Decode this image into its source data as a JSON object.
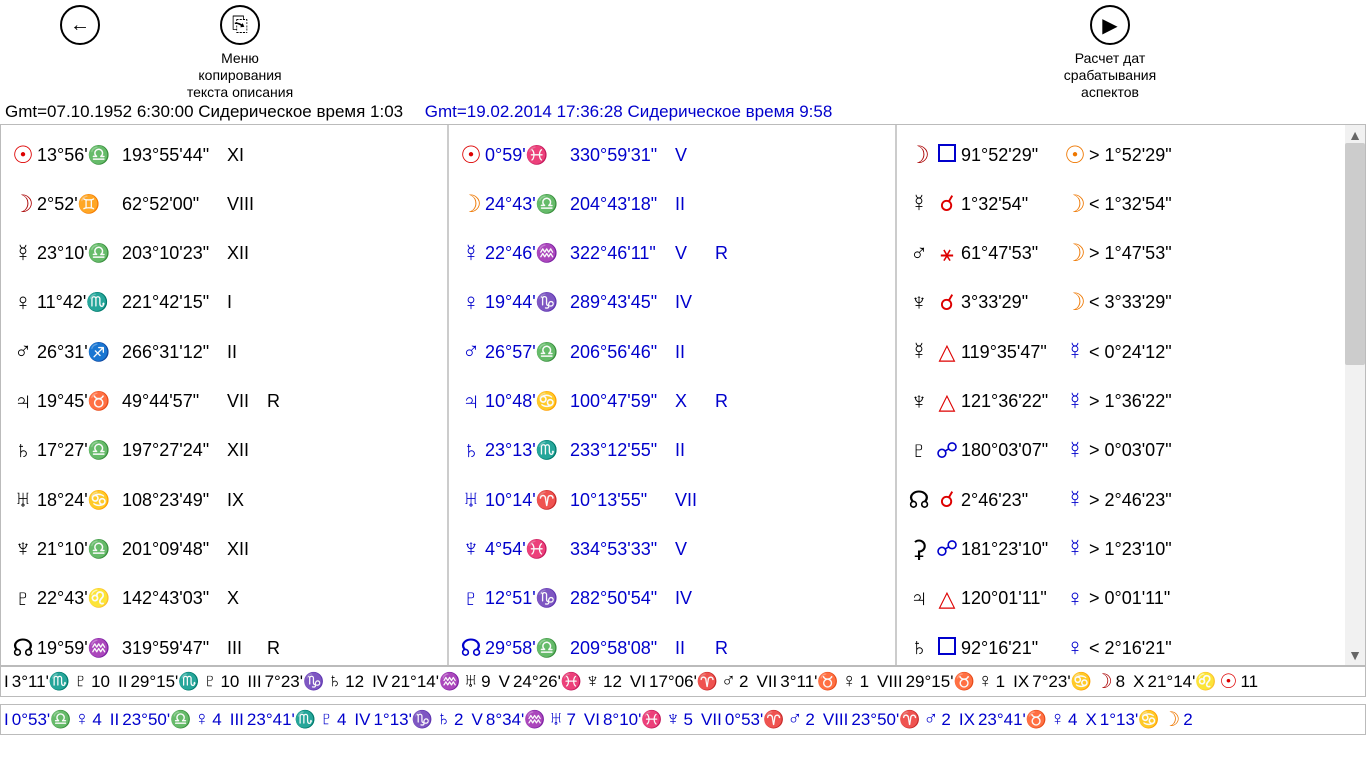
{
  "toolbar": {
    "back_label": "",
    "copy_label": "Меню копирования текста описания",
    "calc_label": "Расчет дат срабатывания аспектов"
  },
  "timestamps": {
    "left": "Gmt=07.10.1952 6:30:00   Сидерическое время 1:03",
    "right": "Gmt=19.02.2014 17:36:28   Сидерическое время 9:58"
  },
  "col1": [
    {
      "g": "☉",
      "gc": "red",
      "p1": "13°56'♎",
      "p2": "193°55'44\"",
      "h": "XI",
      "r": ""
    },
    {
      "g": "☽",
      "gc": "darkred",
      "p1": "2°52'♊",
      "p2": "62°52'00\"",
      "h": "VIII",
      "r": ""
    },
    {
      "g": "☿",
      "gc": "",
      "p1": "23°10'♎",
      "p2": "203°10'23\"",
      "h": "XII",
      "r": ""
    },
    {
      "g": "♀",
      "gc": "",
      "p1": "11°42'♏",
      "p2": "221°42'15\"",
      "h": "I",
      "r": ""
    },
    {
      "g": "♂",
      "gc": "",
      "p1": "26°31'♐",
      "p2": "266°31'12\"",
      "h": "II",
      "r": ""
    },
    {
      "g": "♃",
      "gc": "",
      "p1": "19°45'♉",
      "p2": "49°44'57\"",
      "h": "VII",
      "r": "R"
    },
    {
      "g": "♄",
      "gc": "",
      "p1": "17°27'♎",
      "p2": "197°27'24\"",
      "h": "XII",
      "r": ""
    },
    {
      "g": "♅",
      "gc": "",
      "p1": "18°24'♋",
      "p2": "108°23'49\"",
      "h": "IX",
      "r": ""
    },
    {
      "g": "♆",
      "gc": "",
      "p1": "21°10'♎",
      "p2": "201°09'48\"",
      "h": "XII",
      "r": ""
    },
    {
      "g": "♇",
      "gc": "",
      "p1": "22°43'♌",
      "p2": "142°43'03\"",
      "h": "X",
      "r": ""
    },
    {
      "g": "☊",
      "gc": "",
      "p1": "19°59'♒",
      "p2": "319°59'47\"",
      "h": "III",
      "r": "R"
    }
  ],
  "col2": [
    {
      "g": "☉",
      "gc": "red",
      "p1": "0°59'♓",
      "p2": "330°59'31\"",
      "h": "V",
      "r": ""
    },
    {
      "g": "☽",
      "gc": "orange",
      "p1": "24°43'♎",
      "p2": "204°43'18\"",
      "h": "II",
      "r": ""
    },
    {
      "g": "☿",
      "gc": "",
      "p1": "22°46'♒",
      "p2": "322°46'11\"",
      "h": "V",
      "r": "R"
    },
    {
      "g": "♀",
      "gc": "",
      "p1": "19°44'♑",
      "p2": "289°43'45\"",
      "h": "IV",
      "r": ""
    },
    {
      "g": "♂",
      "gc": "",
      "p1": "26°57'♎",
      "p2": "206°56'46\"",
      "h": "II",
      "r": ""
    },
    {
      "g": "♃",
      "gc": "",
      "p1": "10°48'♋",
      "p2": "100°47'59\"",
      "h": "X",
      "r": "R"
    },
    {
      "g": "♄",
      "gc": "",
      "p1": "23°13'♏",
      "p2": "233°12'55\"",
      "h": "II",
      "r": ""
    },
    {
      "g": "♅",
      "gc": "",
      "p1": "10°14'♈",
      "p2": "10°13'55\"",
      "h": "VII",
      "r": ""
    },
    {
      "g": "♆",
      "gc": "",
      "p1": "4°54'♓",
      "p2": "334°53'33\"",
      "h": "V",
      "r": ""
    },
    {
      "g": "♇",
      "gc": "",
      "p1": "12°51'♑",
      "p2": "282°50'54\"",
      "h": "IV",
      "r": ""
    },
    {
      "g": "☊",
      "gc": "",
      "p1": "29°58'♎",
      "p2": "209°58'08\"",
      "h": "II",
      "r": "R"
    }
  ],
  "col3": [
    {
      "g1": "☽",
      "g1c": "darkred",
      "sym": "□",
      "symc": "blue",
      "symtype": "sq",
      "v": "91°52'29\"",
      "g2": "☉",
      "g2c": "orange",
      "cmp": "> 1°52'29\""
    },
    {
      "g1": "☿",
      "g1c": "",
      "sym": "☌",
      "symc": "red",
      "v": "1°32'54\"",
      "g2": "☽",
      "g2c": "orange",
      "cmp": "< 1°32'54\""
    },
    {
      "g1": "♂",
      "g1c": "",
      "sym": "⚹",
      "symc": "red",
      "v": "61°47'53\"",
      "g2": "☽",
      "g2c": "orange",
      "cmp": "> 1°47'53\""
    },
    {
      "g1": "♆",
      "g1c": "",
      "sym": "☌",
      "symc": "red",
      "v": "3°33'29\"",
      "g2": "☽",
      "g2c": "orange",
      "cmp": "< 3°33'29\""
    },
    {
      "g1": "☿",
      "g1c": "",
      "sym": "△",
      "symc": "red",
      "symtype": "tri",
      "v": "119°35'47\"",
      "g2": "☿",
      "g2c": "blue",
      "cmp": "< 0°24'12\""
    },
    {
      "g1": "♆",
      "g1c": "",
      "sym": "△",
      "symc": "red",
      "symtype": "tri",
      "v": "121°36'22\"",
      "g2": "☿",
      "g2c": "blue",
      "cmp": "> 1°36'22\""
    },
    {
      "g1": "♇",
      "g1c": "",
      "sym": "☍",
      "symc": "blue",
      "v": "180°03'07\"",
      "g2": "☿",
      "g2c": "blue",
      "cmp": "> 0°03'07\""
    },
    {
      "g1": "☊",
      "g1c": "",
      "sym": "☌",
      "symc": "red",
      "v": "2°46'23\"",
      "g2": "☿",
      "g2c": "blue",
      "cmp": "> 2°46'23\""
    },
    {
      "g1": "⚳",
      "g1c": "",
      "sym": "☍",
      "symc": "blue",
      "v": "181°23'10\"",
      "g2": "☿",
      "g2c": "blue",
      "cmp": "> 1°23'10\""
    },
    {
      "g1": "♃",
      "g1c": "",
      "sym": "△",
      "symc": "red",
      "symtype": "tri",
      "v": "120°01'11\"",
      "g2": "♀",
      "g2c": "blue",
      "cmp": "> 0°01'11\""
    },
    {
      "g1": "♄",
      "g1c": "",
      "sym": "□",
      "symc": "blue",
      "symtype": "sq",
      "v": "92°16'21\"",
      "g2": "♀",
      "g2c": "blue",
      "cmp": "< 2°16'21\""
    }
  ],
  "footer1": [
    {
      "rn": "I",
      "deg": "3°11'♏",
      "g": "♇",
      "gc": "",
      "n": "10"
    },
    {
      "rn": "II",
      "deg": "29°15'♏",
      "g": "♇",
      "gc": "",
      "n": "10"
    },
    {
      "rn": "III",
      "deg": "7°23'♑",
      "g": "♄",
      "gc": "",
      "n": "12"
    },
    {
      "rn": "IV",
      "deg": "21°14'♒",
      "g": "♅",
      "gc": "",
      "n": "9"
    },
    {
      "rn": "V",
      "deg": "24°26'♓",
      "g": "♆",
      "gc": "",
      "n": "12"
    },
    {
      "rn": "VI",
      "deg": "17°06'♈",
      "g": "♂",
      "gc": "",
      "n": "2"
    },
    {
      "rn": "VII",
      "deg": "3°11'♉",
      "g": "♀",
      "gc": "",
      "n": "1"
    },
    {
      "rn": "VIII",
      "deg": "29°15'♉",
      "g": "♀",
      "gc": "",
      "n": "1"
    },
    {
      "rn": "IX",
      "deg": "7°23'♋",
      "g": "☽",
      "gc": "darkred",
      "n": "8"
    },
    {
      "rn": "X",
      "deg": "21°14'♌",
      "g": "☉",
      "gc": "red",
      "n": "11"
    }
  ],
  "footer2": [
    {
      "rn": "I",
      "deg": "0°53'♎",
      "g": "♀",
      "gc": "",
      "n": "4"
    },
    {
      "rn": "II",
      "deg": "23°50'♎",
      "g": "♀",
      "gc": "",
      "n": "4"
    },
    {
      "rn": "III",
      "deg": "23°41'♏",
      "g": "♇",
      "gc": "",
      "n": "4"
    },
    {
      "rn": "IV",
      "deg": "1°13'♑",
      "g": "♄",
      "gc": "",
      "n": "2"
    },
    {
      "rn": "V",
      "deg": "8°34'♒",
      "g": "♅",
      "gc": "",
      "n": "7"
    },
    {
      "rn": "VI",
      "deg": "8°10'♓",
      "g": "♆",
      "gc": "",
      "n": "5"
    },
    {
      "rn": "VII",
      "deg": "0°53'♈",
      "g": "♂",
      "gc": "",
      "n": "2"
    },
    {
      "rn": "VIII",
      "deg": "23°50'♈",
      "g": "♂",
      "gc": "",
      "n": "2"
    },
    {
      "rn": "IX",
      "deg": "23°41'♉",
      "g": "♀",
      "gc": "",
      "n": "4"
    },
    {
      "rn": "X",
      "deg": "1°13'♋",
      "g": "☽",
      "gc": "orange",
      "n": "2"
    }
  ]
}
